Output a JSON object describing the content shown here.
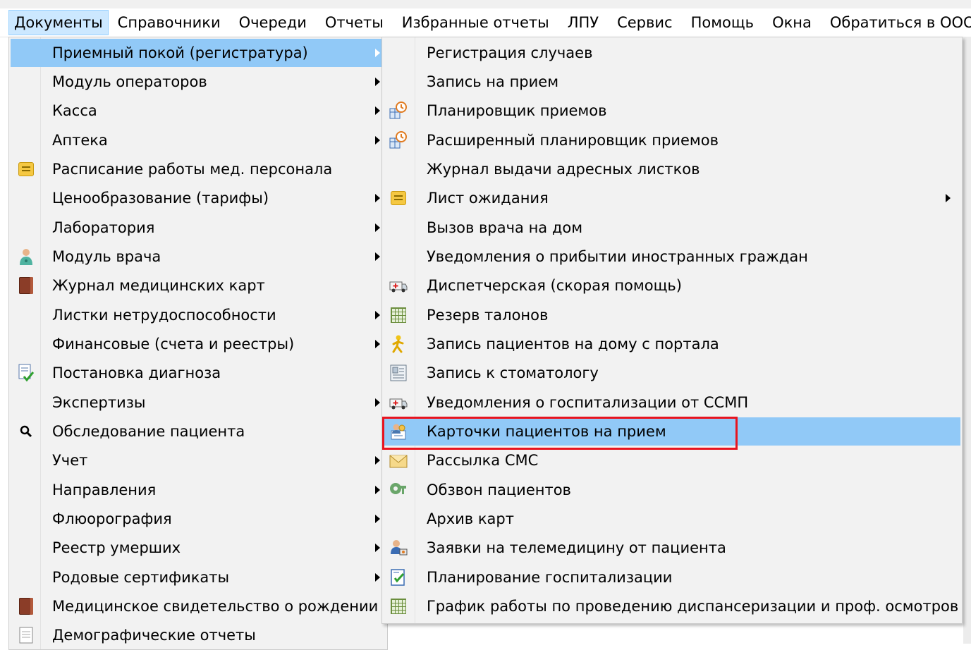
{
  "menubar": {
    "items": [
      "Документы",
      "Справочники",
      "Очереди",
      "Отчеты",
      "Избранные отчеты",
      "ЛПУ",
      "Сервис",
      "Помощь",
      "Окна",
      "Обратиться в ООО \"М"
    ]
  },
  "main_menu": {
    "items": [
      {
        "label": "Приемный покой (регистратура)",
        "submenu": true,
        "highlighted": true,
        "icon": ""
      },
      {
        "label": "Модуль операторов",
        "submenu": true,
        "icon": ""
      },
      {
        "label": "Касса",
        "submenu": true,
        "icon": ""
      },
      {
        "label": "Аптека",
        "submenu": true,
        "icon": ""
      },
      {
        "label": "Расписание работы мед. персонала",
        "submenu": false,
        "icon": "note-icon"
      },
      {
        "label": "Ценообразование (тарифы)",
        "submenu": true,
        "icon": ""
      },
      {
        "label": "Лаборатория",
        "submenu": true,
        "icon": ""
      },
      {
        "label": "Модуль врача",
        "submenu": true,
        "icon": "doctor-icon"
      },
      {
        "label": "Журнал медицинских карт",
        "submenu": false,
        "icon": "book-icon"
      },
      {
        "label": "Листки нетрудоспособности",
        "submenu": true,
        "icon": ""
      },
      {
        "label": "Финансовые (счета и реестры)",
        "submenu": true,
        "icon": ""
      },
      {
        "label": "Постановка диагноза",
        "submenu": false,
        "icon": "diagnosis-check-icon"
      },
      {
        "label": "Экспертизы",
        "submenu": true,
        "icon": ""
      },
      {
        "label": "Обследование пациента",
        "submenu": false,
        "icon": "magnifier-icon"
      },
      {
        "label": "Учет",
        "submenu": true,
        "icon": ""
      },
      {
        "label": "Направления",
        "submenu": true,
        "icon": ""
      },
      {
        "label": "Флюорография",
        "submenu": true,
        "icon": ""
      },
      {
        "label": "Реестр умерших",
        "submenu": true,
        "icon": ""
      },
      {
        "label": "Родовые сертификаты",
        "submenu": true,
        "icon": ""
      },
      {
        "label": "Медицинское свидетельство о рождении",
        "submenu": false,
        "icon": "book-icon"
      },
      {
        "label": "Демографические отчеты",
        "submenu": false,
        "icon": "document-icon"
      }
    ]
  },
  "submenu": {
    "items": [
      {
        "label": "Регистрация случаев",
        "icon": "book-icon"
      },
      {
        "label": "Запись на прием",
        "icon": "book-icon"
      },
      {
        "label": "Планировщик приемов",
        "icon": "scheduler-clock-icon"
      },
      {
        "label": "Расширенный планировщик приемов",
        "icon": "scheduler-clock-icon"
      },
      {
        "label": "Журнал выдачи адресных листков",
        "icon": "book-icon"
      },
      {
        "label": "Лист ожидания",
        "icon": "note-icon",
        "submenu": true
      },
      {
        "label": "Вызов врача на дом",
        "icon": "book-icon"
      },
      {
        "label": "Уведомления о прибытии иностранных граждан",
        "icon": "book-icon"
      },
      {
        "label": "Диспетчерская (скорая помощь)",
        "icon": "ambulance-icon"
      },
      {
        "label": "Резерв талонов",
        "icon": "grid-icon"
      },
      {
        "label": "Запись пациентов на дому с портала",
        "icon": "walking-person-icon"
      },
      {
        "label": "Запись к стоматологу",
        "icon": "dental-card-icon"
      },
      {
        "label": "Уведомления о госпитализации от ССМП",
        "icon": "ambulance-icon"
      },
      {
        "label": "Карточки пациентов на прием",
        "icon": "patient-cards-icon",
        "highlighted": true
      },
      {
        "label": "Рассылка СМС",
        "icon": "envelope-icon"
      },
      {
        "label": "Обзвон пациентов",
        "icon": "phone-call-icon"
      },
      {
        "label": "Архив карт",
        "icon": "book-icon"
      },
      {
        "label": "Заявки на телемедицину от пациента",
        "icon": "telemedicine-icon"
      },
      {
        "label": "Планирование госпитализации",
        "icon": "hospitalization-plan-icon"
      },
      {
        "label": "График работы по проведению диспансеризации и проф. осмотров",
        "icon": "grid-icon"
      }
    ]
  },
  "colors": {
    "highlight": "#91c9f7",
    "menu_bg": "#f2f2f2",
    "annotation_box": "#e8141f"
  }
}
